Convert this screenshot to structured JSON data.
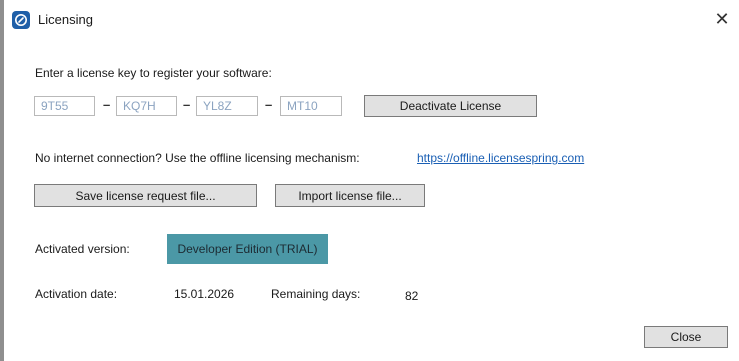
{
  "window": {
    "title": "Licensing",
    "close_glyph": "✕"
  },
  "license": {
    "prompt": "Enter a license key to register your software:",
    "key_parts": [
      "9T55",
      "KQ7H",
      "YL8Z",
      "MT10"
    ],
    "separator": "–",
    "deactivate_label": "Deactivate License"
  },
  "offline": {
    "text": "No internet connection? Use the offline licensing mechanism:",
    "link": "https://offline.licensespring.com",
    "save_request_label": "Save license request file...",
    "import_label": "Import license file..."
  },
  "status": {
    "version_label": "Activated version:",
    "version_value": "Developer Edition (TRIAL)",
    "date_label": "Activation date:",
    "date_value": "15.01.2026",
    "remaining_label": "Remaining days:",
    "remaining_value": "82"
  },
  "footer": {
    "close_label": "Close"
  },
  "colors": {
    "accent_badge": "#4b98a6",
    "link": "#1a5fb4",
    "button_bg": "#e1e1e1"
  },
  "icons": {
    "app": "licensing-app-icon",
    "close": "close-icon"
  }
}
